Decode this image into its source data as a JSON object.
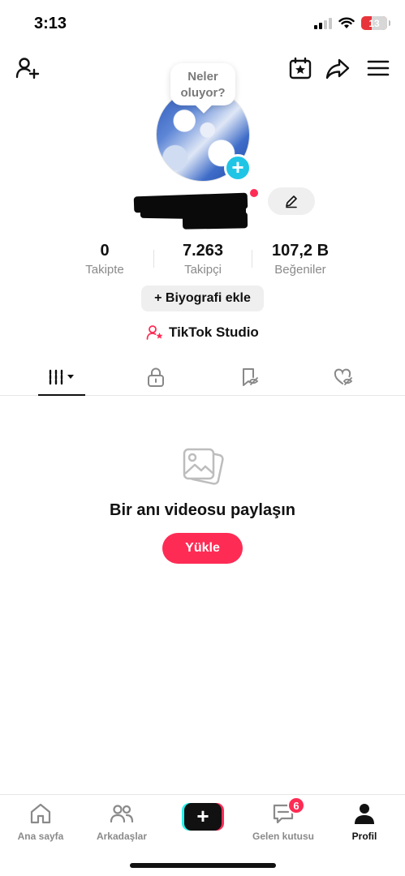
{
  "status_bar": {
    "time": "3:13",
    "battery": "13"
  },
  "profile": {
    "bubble_line1": "Neler",
    "bubble_line2": "oluyor?",
    "stats": [
      {
        "value": "0",
        "label": "Takipte"
      },
      {
        "value": "7.263",
        "label": "Takipçi"
      },
      {
        "value": "107,2 B",
        "label": "Beğeniler"
      }
    ],
    "bio_button": "+ Biyografi ekle",
    "studio_label": "TikTok Studio"
  },
  "empty_state": {
    "title": "Bir anı videosu paylaşın",
    "upload_button": "Yükle"
  },
  "bottom_nav": {
    "items": [
      {
        "label": "Ana sayfa",
        "icon": "home-icon"
      },
      {
        "label": "Arkadaşlar",
        "icon": "friends-icon"
      },
      {
        "label": "",
        "icon": "create-icon"
      },
      {
        "label": "Gelen kutusu",
        "icon": "inbox-icon",
        "badge": "6"
      },
      {
        "label": "Profil",
        "icon": "profile-icon"
      }
    ]
  },
  "colors": {
    "accent": "#fe2c55",
    "cyan": "#20c5e6",
    "muted": "#8a8a8a"
  }
}
